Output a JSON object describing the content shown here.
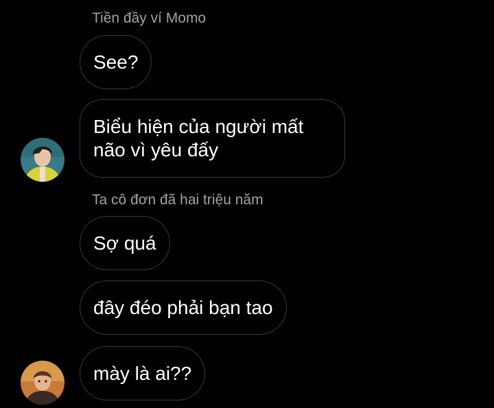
{
  "colors": {
    "background": "#000000",
    "bubble_border": "#3a3a3a",
    "sender_name": "#a3a3a3",
    "message_text": "#ffffff"
  },
  "groups": [
    {
      "sender": "Tiền đầy ví Momo",
      "avatar_icon": "user-avatar-icon",
      "messages": [
        "See?",
        "Biểu hiện của người mất não vì yêu đấy"
      ]
    },
    {
      "sender": "Ta cô đơn đã hai triệu năm",
      "avatar_icon": "user-avatar-icon",
      "messages": [
        "Sợ quá",
        "đây đéo phải bạn tao",
        "mày là ai??"
      ]
    }
  ]
}
